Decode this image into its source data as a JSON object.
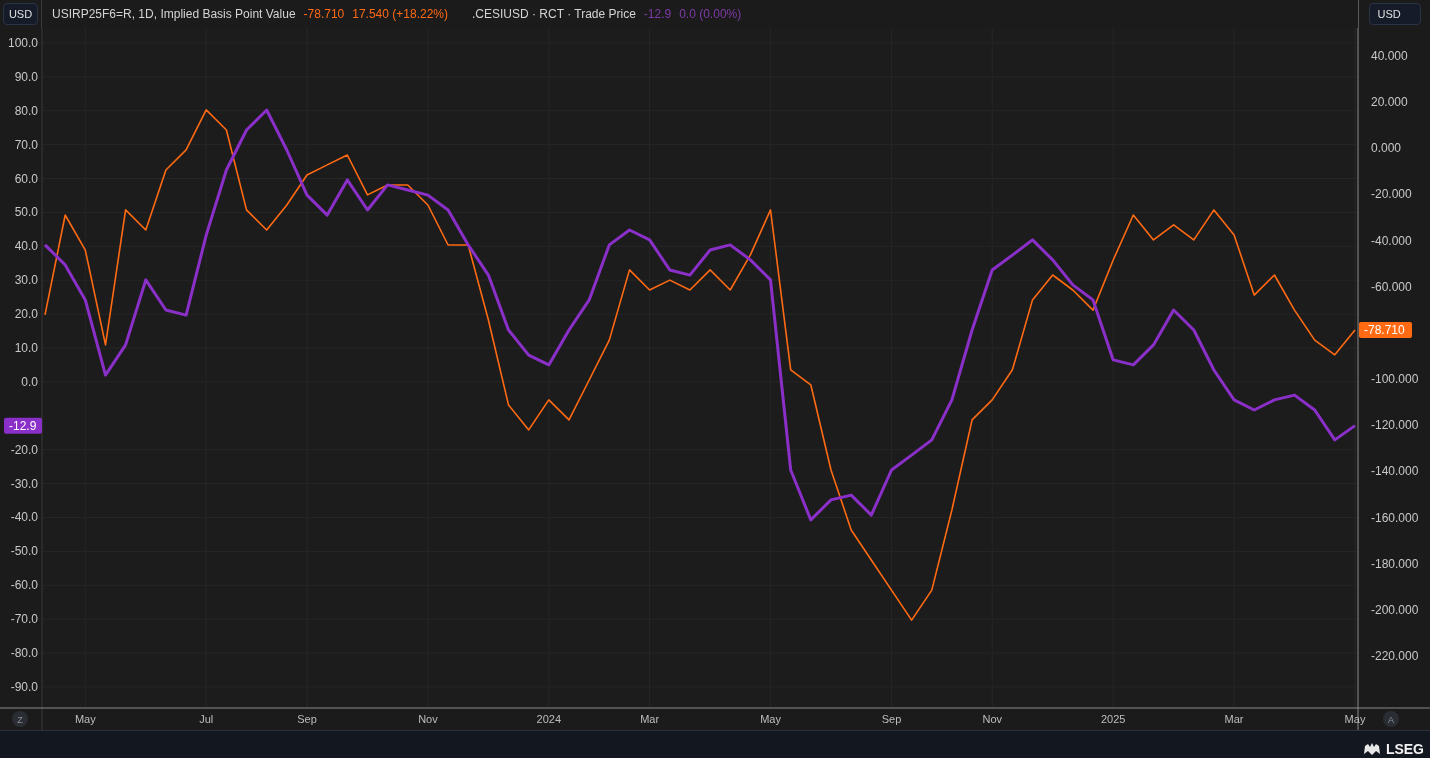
{
  "header": {
    "left_currency": "USD",
    "right_currency": "USD",
    "legends": [
      {
        "name": "USIRP25F6=R, 1D, Implied Basis Point Value",
        "value": "-78.710",
        "change": "17.540 (+18.22%)",
        "color": "#ff6a13"
      },
      {
        "name": ".CESIUSD · RCT · Trade Price",
        "value": "-12.9",
        "change": "0.0 (0.00%)",
        "color": "#7e3aa8"
      }
    ]
  },
  "chart": {
    "chart_data": {
      "type": "line",
      "categories": [
        null,
        null,
        "May",
        null,
        null,
        null,
        null,
        null,
        "Jul",
        null,
        null,
        null,
        null,
        "Sep",
        null,
        null,
        null,
        null,
        null,
        "Nov",
        null,
        null,
        null,
        null,
        null,
        "2024",
        null,
        null,
        null,
        null,
        "Mar",
        null,
        null,
        null,
        null,
        null,
        "May",
        null,
        null,
        null,
        null,
        null,
        "Sep",
        null,
        null,
        null,
        null,
        "Nov",
        null,
        null,
        null,
        null,
        null,
        "2025",
        null,
        null,
        null,
        null,
        null,
        "Mar",
        null,
        null,
        null,
        null,
        null,
        "May"
      ],
      "ylim": [
        -96.2,
        104.4
      ],
      "yticks": [
        {
          "value": 100,
          "label": "100.0"
        },
        {
          "value": 90,
          "label": "90.0"
        },
        {
          "value": 80,
          "label": "80.0"
        },
        {
          "value": 70,
          "label": "70.0"
        },
        {
          "value": 60,
          "label": "60.0"
        },
        {
          "value": 50,
          "label": "50.0"
        },
        {
          "value": 40,
          "label": "40.0"
        },
        {
          "value": 30,
          "label": "30.0"
        },
        {
          "value": 20,
          "label": "20.0"
        },
        {
          "value": 10,
          "label": "10.0"
        },
        {
          "value": 0,
          "label": "0.0"
        },
        {
          "value": -20,
          "label": "-20.0"
        },
        {
          "value": -30,
          "label": "-30.0"
        },
        {
          "value": -40,
          "label": "-40.0"
        },
        {
          "value": -50,
          "label": "-50.0"
        },
        {
          "value": -60,
          "label": "-60.0"
        },
        {
          "value": -70,
          "label": "-70.0"
        },
        {
          "value": -80,
          "label": "-80.0"
        },
        {
          "value": -90,
          "label": "-90.0"
        }
      ],
      "y2lim": [
        -242.5,
        52.1
      ],
      "y2ticks": [
        {
          "value": 40,
          "label": "40.000"
        },
        {
          "value": 20,
          "label": "20.000"
        },
        {
          "value": 0,
          "label": "0.000"
        },
        {
          "value": -20,
          "label": "-20.000"
        },
        {
          "value": -40,
          "label": "-40.000"
        },
        {
          "value": -60,
          "label": "-60.000"
        },
        {
          "value": -100,
          "label": "-100.000"
        },
        {
          "value": -120,
          "label": "-120.000"
        },
        {
          "value": -140,
          "label": "-140.000"
        },
        {
          "value": -160,
          "label": "-160.000"
        },
        {
          "value": -180,
          "label": "-180.000"
        },
        {
          "value": -200,
          "label": "-200.000"
        },
        {
          "value": -220,
          "label": "-220.000"
        }
      ],
      "series": [
        {
          "color": "#ff6a13",
          "axis": "y2",
          "values": [
            -72.2,
            -28.9,
            -44.1,
            -85.2,
            -26.7,
            -35.4,
            -9.4,
            -0.7,
            16.6,
            7.9,
            -26.7,
            -35.4,
            -24.6,
            -11.6,
            -7.2,
            -2.9,
            -20.2,
            -15.9,
            -15.9,
            -24.6,
            -41.9,
            -41.9,
            -74.4,
            -111.2,
            -122.0,
            -109.0,
            -117.7,
            -100.4,
            -83.1,
            -52.7,
            -61.4,
            -57.1,
            -61.4,
            -52.7,
            -61.4,
            -46.2,
            -26.7,
            -96.0,
            -102.5,
            -139.4,
            -165.4,
            -178.4,
            -191.4,
            -204.4,
            -191.4,
            -156.7,
            -117.7,
            -109.0,
            -96.0,
            -65.7,
            -54.9,
            -61.4,
            -70.1,
            -48.4,
            -28.9,
            -39.7,
            -33.2,
            -39.7,
            -26.7,
            -37.6,
            -63.6,
            -54.9,
            -70.1,
            -83.1,
            -89.5,
            -78.7
          ]
        },
        {
          "color": "#8b2fc9",
          "values": [
            40.4,
            34.5,
            24.2,
            2.0,
            10.9,
            30.1,
            21.2,
            19.7,
            43.3,
            62.5,
            74.3,
            80.2,
            68.4,
            55.1,
            49.2,
            59.6,
            50.7,
            58.1,
            56.6,
            55.1,
            50.7,
            40.4,
            31.5,
            15.3,
            7.9,
            5.0,
            15.3,
            24.2,
            40.4,
            44.8,
            41.9,
            33.0,
            31.5,
            38.9,
            40.4,
            36.0,
            30.1,
            -26.0,
            -40.7,
            -34.8,
            -33.4,
            -39.3,
            -26.0,
            -21.6,
            -17.1,
            -5.3,
            15.3,
            33.0,
            37.4,
            41.9,
            36.0,
            28.6,
            24.2,
            6.5,
            5.0,
            10.9,
            21.2,
            15.3,
            3.5,
            -5.3,
            -8.3,
            -5.3,
            -3.9,
            -8.3,
            -17.1,
            -12.9
          ]
        }
      ],
      "grid": true
    },
    "price_labels": [
      "-78.710",
      "-12.9"
    ]
  },
  "axis_buttons": [
    "Z",
    "A"
  ],
  "footer": {
    "logo": "LSEG"
  }
}
